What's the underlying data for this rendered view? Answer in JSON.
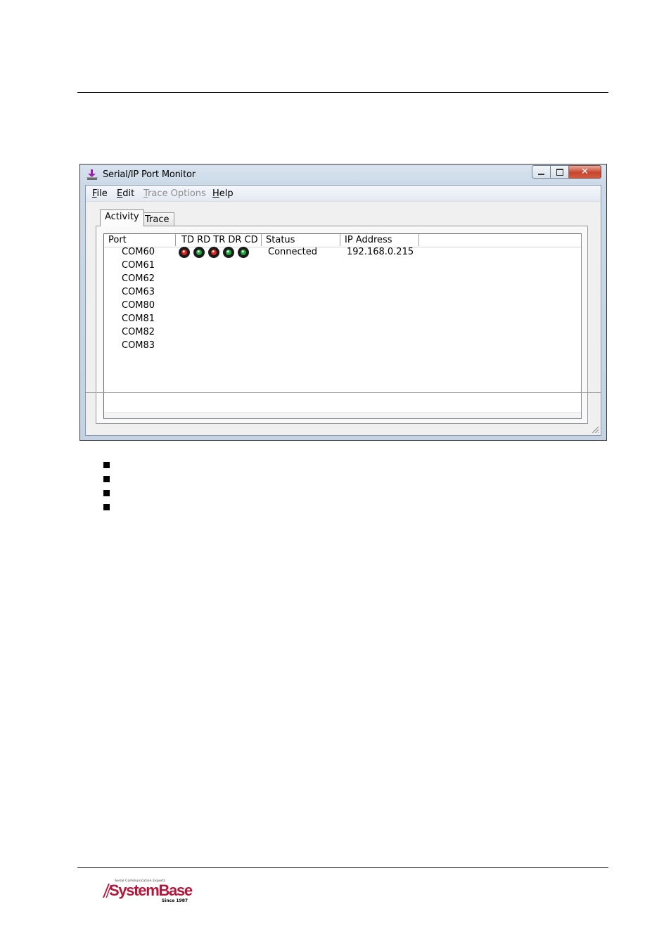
{
  "window": {
    "title": "Serial/IP Port Monitor",
    "close_glyph": "✕"
  },
  "menu": [
    {
      "label_mnemonic": "F",
      "label_rest": "ile",
      "enabled": true
    },
    {
      "label_mnemonic": "E",
      "label_rest": "dit",
      "enabled": true
    },
    {
      "label_mnemonic": "T",
      "label_rest": "race Options",
      "enabled": false
    },
    {
      "label_mnemonic": "H",
      "label_rest": "elp",
      "enabled": true
    }
  ],
  "tabs": [
    {
      "label": "Activity",
      "selected": true
    },
    {
      "label": "Trace",
      "selected": false
    }
  ],
  "list": {
    "columns": {
      "port": "Port",
      "signals": "TD RD TR DR CD",
      "status": "Status",
      "ip": "IP Address"
    },
    "rows": [
      {
        "port": "COM60",
        "status": "Connected",
        "ip": "192.168.0.215",
        "leds": [
          {
            "name": "TD",
            "color": "#e0201c"
          },
          {
            "name": "RD",
            "color": "#1aa83a"
          },
          {
            "name": "TR",
            "color": "#e0201c"
          },
          {
            "name": "DR",
            "color": "#1aa83a"
          },
          {
            "name": "CD",
            "color": "#1aa83a"
          }
        ]
      },
      {
        "port": "COM61"
      },
      {
        "port": "COM62"
      },
      {
        "port": "COM63"
      },
      {
        "port": "COM80"
      },
      {
        "port": "COM81"
      },
      {
        "port": "COM82"
      },
      {
        "port": "COM83"
      }
    ]
  },
  "bullets_count": 4,
  "footer": {
    "logo_tagline": "Serial Communication Experts",
    "logo_name": "SystemBase",
    "logo_since": "Since 1987"
  },
  "colors": {
    "logo_brand": "#b5163b",
    "led_red": "#e0201c",
    "led_green": "#1aa83a"
  }
}
